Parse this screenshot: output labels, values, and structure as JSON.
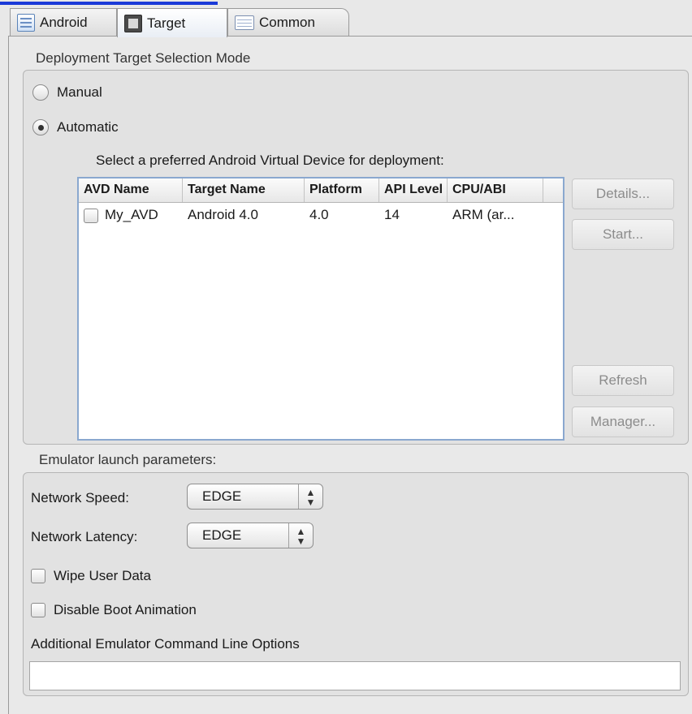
{
  "tabs": [
    {
      "label": "Android",
      "icon": "android-config-icon"
    },
    {
      "label": "Target",
      "icon": "target-device-icon"
    },
    {
      "label": "Common",
      "icon": "common-settings-icon"
    }
  ],
  "deployment": {
    "section_title": "Deployment Target Selection Mode",
    "manual_label": "Manual",
    "automatic_label": "Automatic",
    "selected_mode": "Automatic",
    "prompt": "Select a preferred Android Virtual Device for deployment:",
    "columns": [
      "AVD Name",
      "Target Name",
      "Platform",
      "API Level",
      "CPU/ABI"
    ],
    "rows": [
      {
        "avd_name": "My_AVD",
        "target_name": "Android 4.0",
        "platform": "4.0",
        "api_level": "14",
        "cpu_abi": "ARM (ar...",
        "checked": false
      }
    ],
    "buttons": {
      "details": "Details...",
      "start": "Start...",
      "refresh": "Refresh",
      "manager": "Manager..."
    }
  },
  "emulator": {
    "section_title": "Emulator launch parameters:",
    "network_speed_label": "Network Speed:",
    "network_speed_value": "EDGE",
    "network_latency_label": "Network Latency:",
    "network_latency_value": "EDGE",
    "wipe_user_data_label": "Wipe User Data",
    "disable_boot_animation_label": "Disable Boot Animation",
    "additional_options_label": "Additional Emulator Command Line Options",
    "additional_options_value": ""
  }
}
